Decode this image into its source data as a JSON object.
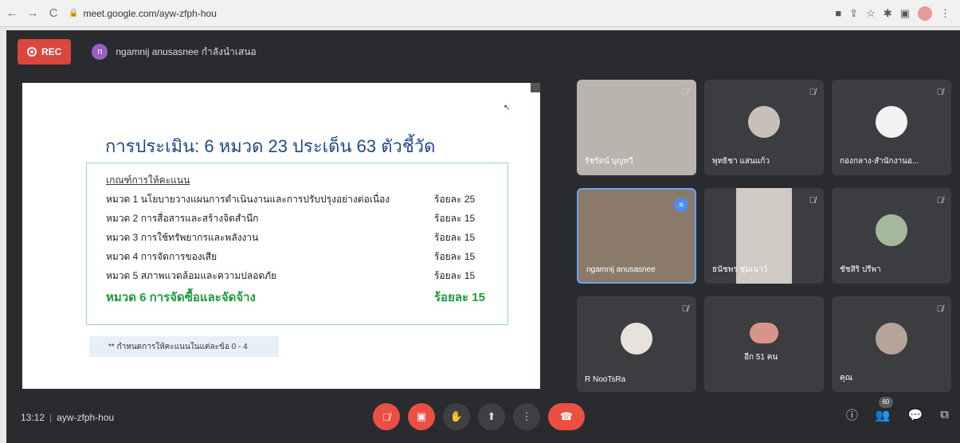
{
  "browser": {
    "url": "meet.google.com/ayw-zfph-hou",
    "back_icon": "←",
    "forward_icon": "→",
    "reload_icon": "C",
    "extension_icons": [
      "■",
      "⇪",
      "☆",
      "✱",
      "▣"
    ],
    "menu_icon": "⋮"
  },
  "topbar": {
    "rec_label": "REC",
    "presenter_initial": "n",
    "presenter_text": "ngamnij anusasnee กำลังนำเสนอ"
  },
  "slide": {
    "title": "การประเมิน:  6 หมวด  23 ประเด็น 63 ตัวชี้วัด",
    "criteria_heading": "เกณฑ์การให้คะแนน",
    "rows": [
      {
        "label": "หมวด 1 นโยบายวางแผนการดำเนินงานและการปรับปรุงอย่างต่อเนื่อง",
        "pct": "ร้อยละ 25"
      },
      {
        "label": "หมวด 2 การสื่อสารและสร้างจิตสำนึก",
        "pct": "ร้อยละ 15"
      },
      {
        "label": "หมวด 3 การใช้ทรัพยากรและพลังงาน",
        "pct": "ร้อยละ 15"
      },
      {
        "label": "หมวด 4 การจัดการของเสีย",
        "pct": "ร้อยละ 15"
      },
      {
        "label": "หมวด 5 สภาพแวดล้อมและความปลอดภัย",
        "pct": "ร้อยละ 15"
      },
      {
        "label": "หมวด 6 การจัดซื้อและจัดจ้าง",
        "pct": "ร้อยละ 15"
      }
    ],
    "note": "** กำหนดการให้คะแนนในแต่ละข้อ 0 - 4"
  },
  "participants": [
    {
      "name": "รัชรัตน์ บุญทวี",
      "muted": true
    },
    {
      "name": "พุทธิชา แสนแก้ว",
      "muted": true
    },
    {
      "name": "กองกลาง-สำนักงานอ...",
      "muted": true
    },
    {
      "name": "ngamnij anusasnee",
      "muted": false,
      "speaking": true
    },
    {
      "name": "ธนัชพร ชุ่มเนาว์",
      "muted": true
    },
    {
      "name": "ชัชสิริ ปรีพา",
      "muted": true
    },
    {
      "name": "R NooTsRa",
      "muted": true
    },
    {
      "name": "อีก 51 คน",
      "muted": false
    },
    {
      "name": "คุณ",
      "muted": true
    }
  ],
  "bottom": {
    "time": "13:12",
    "separator": "|",
    "meeting_code": "ayw-zfph-hou",
    "people_count": "60"
  },
  "colors": {
    "accent_red": "#ea4f42",
    "title_blue": "#1e4a86",
    "highlight_green": "#1f9a3a",
    "meet_bg": "#2a2b2f"
  }
}
